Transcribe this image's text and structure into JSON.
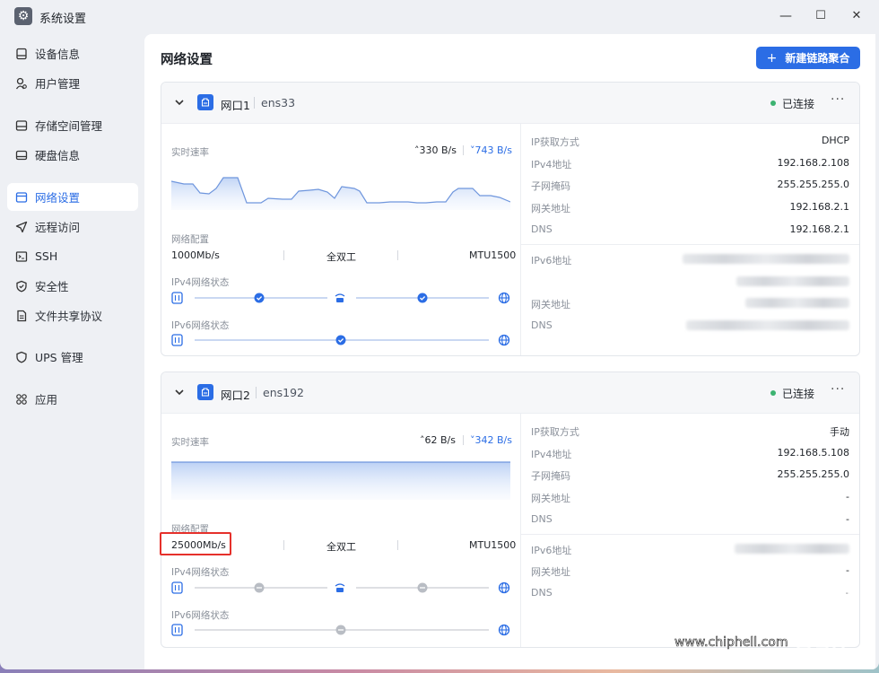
{
  "window": {
    "title": "系统设置",
    "controls": {
      "minimize": "—",
      "maximize": "☐",
      "close": "✕"
    }
  },
  "sidebar": {
    "items": [
      {
        "label": "设备信息",
        "icon": "device-icon"
      },
      {
        "label": "用户管理",
        "icon": "user-icon"
      },
      {
        "label": "存储空间管理",
        "icon": "storage-icon"
      },
      {
        "label": "硬盘信息",
        "icon": "disk-icon"
      },
      {
        "label": "网络设置",
        "icon": "network-icon",
        "active": true
      },
      {
        "label": "远程访问",
        "icon": "send-icon"
      },
      {
        "label": "SSH",
        "icon": "terminal-icon"
      },
      {
        "label": "安全性",
        "icon": "shield-icon"
      },
      {
        "label": "文件共享协议",
        "icon": "file-icon"
      },
      {
        "label": "UPS 管理",
        "icon": "ups-icon"
      },
      {
        "label": "应用",
        "icon": "apps-icon"
      }
    ]
  },
  "main": {
    "title": "网络设置",
    "new_bond_button": "新建链路聚合"
  },
  "ports": [
    {
      "name": "网口1",
      "device": "ens33",
      "status": "已连接",
      "more": "···",
      "realtime_label": "实时速率",
      "rate_up": "330 B/s",
      "rate_down": "743 B/s",
      "config_label": "网络配置",
      "speed": "1000Mb/s",
      "duplex": "全双工",
      "mtu": "MTU1500",
      "ipv4_status_label": "IPv4网络状态",
      "ipv6_status_label": "IPv6网络状态",
      "ipv4_connected": true,
      "ipv6_connected": true,
      "info": {
        "ip_method_label": "IP获取方式",
        "ip_method": "DHCP",
        "ipv4_label": "IPv4地址",
        "ipv4": "192.168.2.108",
        "mask_label": "子网掩码",
        "mask": "255.255.255.0",
        "gateway_label": "网关地址",
        "gateway": "192.168.2.1",
        "dns_label": "DNS",
        "dns": "192.168.2.1",
        "ipv6_label": "IPv6地址",
        "gateway6_label": "网关地址",
        "dns6_label": "DNS"
      }
    },
    {
      "name": "网口2",
      "device": "ens192",
      "status": "已连接",
      "more": "···",
      "realtime_label": "实时速率",
      "rate_up": "62 B/s",
      "rate_down": "342 B/s",
      "config_label": "网络配置",
      "speed": "25000Mb/s",
      "duplex": "全双工",
      "mtu": "MTU1500",
      "ipv4_status_label": "IPv4网络状态",
      "ipv6_status_label": "IPv6网络状态",
      "ipv4_connected": false,
      "ipv6_connected": false,
      "info": {
        "ip_method_label": "IP获取方式",
        "ip_method": "手动",
        "ipv4_label": "IPv4地址",
        "ipv4": "192.168.5.108",
        "mask_label": "子网掩码",
        "mask": "255.255.255.0",
        "gateway_label": "网关地址",
        "gateway": "-",
        "dns_label": "DNS",
        "dns": "-",
        "ipv6_label": "IPv6地址",
        "gateway6_label": "网关地址",
        "gateway6": "-",
        "dns6_label": "DNS",
        "dns6": "-"
      }
    }
  ],
  "watermark": "www.chiphell.com",
  "colors": {
    "accent": "#2b6de5",
    "connected": "#3cb371",
    "highlight": "#e5302b"
  }
}
